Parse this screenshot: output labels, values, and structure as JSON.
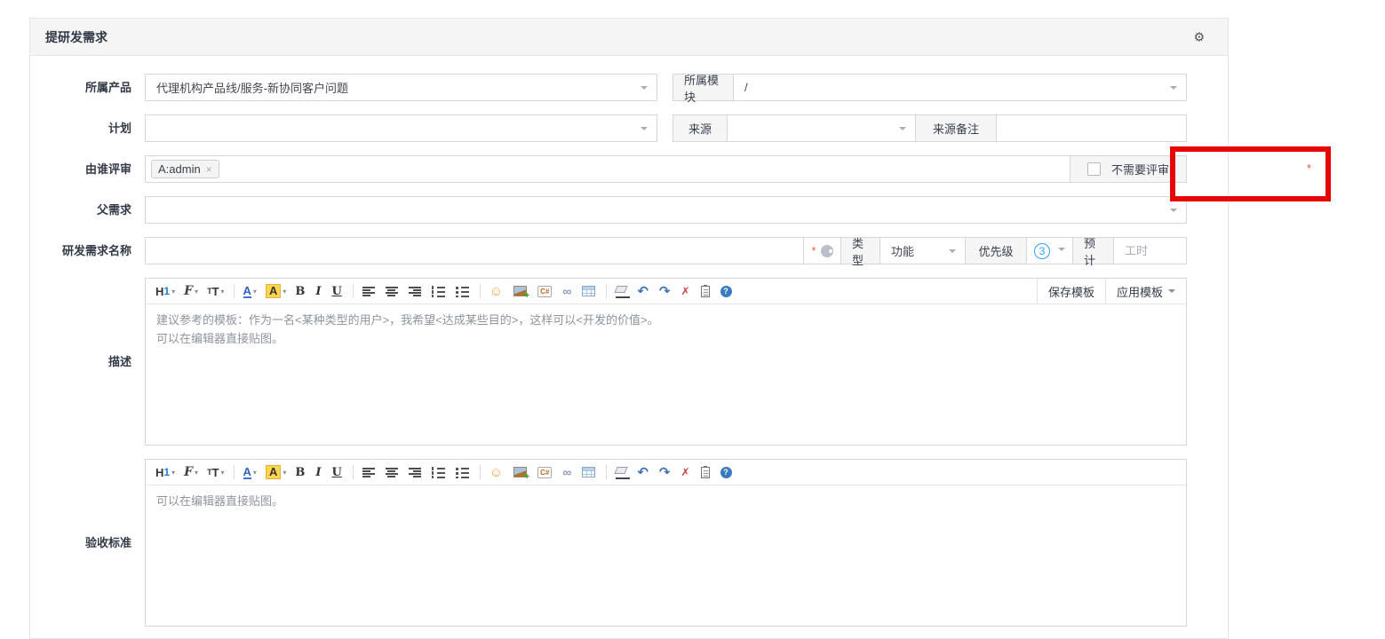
{
  "panel": {
    "title": "提研发需求",
    "gear_icon": "⚙"
  },
  "colors": {
    "annotation_red": "#e60505",
    "priority_blue": "#2ea1f8",
    "required_red": "#e3584f",
    "header_bg": "#f5f5f5"
  },
  "fields": {
    "product": {
      "label": "所属产品",
      "value": "代理机构产品线/服务-新协同客户问题"
    },
    "module": {
      "label": "所属模块",
      "value": "/"
    },
    "plan": {
      "label": "计划",
      "value": ""
    },
    "source": {
      "label": "来源",
      "value": ""
    },
    "source_note": {
      "label": "来源备注",
      "value": ""
    },
    "reviewer": {
      "label": "由谁评审",
      "tag": "A:admin",
      "tag_remove": "×",
      "checkbox_label": "不需要评审",
      "required_mark": "*"
    },
    "parent": {
      "label": "父需求",
      "value": ""
    },
    "story_name": {
      "label": "研发需求名称",
      "value": "",
      "required_mark": "*"
    },
    "type": {
      "label": "类型",
      "value": "功能"
    },
    "priority": {
      "label": "优先级",
      "value": "3"
    },
    "estimate": {
      "label": "预计",
      "placeholder": "工时"
    },
    "description": {
      "label": "描述",
      "placeholder_lines": [
        "建议参考的模板：作为一名<某种类型的用户>，我希望<达成某些目的>，这样可以<开发的价值>。",
        "可以在编辑器直接贴图。"
      ],
      "save_template": "保存模板",
      "apply_template": "应用模板"
    },
    "acceptance": {
      "label": "验收标准",
      "placeholder_lines": [
        "可以在编辑器直接贴图。"
      ]
    }
  },
  "toolbar": {
    "items": [
      {
        "name": "heading-icon",
        "glyph": "H",
        "glyph2": "1",
        "caret": "▾",
        "cls": "tbtn tb-h1",
        "interactable": "true"
      },
      {
        "name": "font-family-icon",
        "glyph": "F",
        "caret": "▾",
        "cls": "tbtn tb-ff",
        "interactable": "true"
      },
      {
        "name": "font-size-icon",
        "glyph": "T",
        "glyph2": "T",
        "caret": "▾",
        "cls": "tbtn tb-fs",
        "interactable": "true"
      },
      {
        "name": "separator",
        "cls": "tb-sep",
        "interactable": "false"
      },
      {
        "name": "font-color-icon",
        "glyph": "A",
        "caret": "▾",
        "cls": "tbtn tb-fc",
        "interactable": "true"
      },
      {
        "name": "highlight-color-icon",
        "glyph": "A",
        "caret": "▾",
        "cls": "tbtn tb-hl",
        "interactable": "true"
      },
      {
        "name": "bold-icon",
        "glyph": "B",
        "cls": "tbtn tb-b",
        "interactable": "true"
      },
      {
        "name": "italic-icon",
        "glyph": "I",
        "cls": "tbtn tb-i",
        "interactable": "true"
      },
      {
        "name": "underline-icon",
        "glyph": "U",
        "cls": "tbtn tb-u",
        "interactable": "true"
      },
      {
        "name": "separator",
        "cls": "tb-sep",
        "interactable": "false"
      },
      {
        "name": "align-left-icon",
        "cls": "tbtn tb-al",
        "interactable": "true"
      },
      {
        "name": "align-center-icon",
        "cls": "tbtn tb-ac",
        "interactable": "true"
      },
      {
        "name": "align-right-icon",
        "cls": "tbtn tb-ar",
        "interactable": "true"
      },
      {
        "name": "ordered-list-icon",
        "cls": "tbtn tb-ol",
        "interactable": "true"
      },
      {
        "name": "unordered-list-icon",
        "cls": "tbtn tb-ul",
        "interactable": "true"
      },
      {
        "name": "separator",
        "cls": "tb-sep",
        "interactable": "false"
      },
      {
        "name": "emoticon-icon",
        "glyph": "☺",
        "cls": "tbtn tb-smile",
        "interactable": "true"
      },
      {
        "name": "insert-image-icon",
        "cls": "tbtn tb-img",
        "interactable": "true"
      },
      {
        "name": "code-snippet-icon",
        "glyph": "C#",
        "cls": "tbtn tb-code",
        "interactable": "true"
      },
      {
        "name": "link-icon",
        "glyph": "∞",
        "cls": "tbtn tb-link",
        "interactable": "true"
      },
      {
        "name": "table-icon",
        "cls": "tbtn tb-table",
        "interactable": "true"
      },
      {
        "name": "separator",
        "cls": "tb-sep",
        "interactable": "false"
      },
      {
        "name": "remove-format-icon",
        "cls": "tbtn tb-eraser",
        "interactable": "true"
      },
      {
        "name": "undo-icon",
        "glyph": "↶",
        "cls": "tbtn tb-undo",
        "interactable": "true"
      },
      {
        "name": "redo-icon",
        "glyph": "↷",
        "cls": "tbtn tb-redo",
        "interactable": "true"
      },
      {
        "name": "fullscreen-icon",
        "glyph": "✗",
        "cls": "tbtn tb-fullscr",
        "interactable": "true"
      },
      {
        "name": "paste-icon",
        "cls": "tbtn tb-paste",
        "interactable": "true"
      },
      {
        "name": "help-icon",
        "glyph": "?",
        "cls": "tbtn tb-help",
        "interactable": "true"
      }
    ]
  }
}
